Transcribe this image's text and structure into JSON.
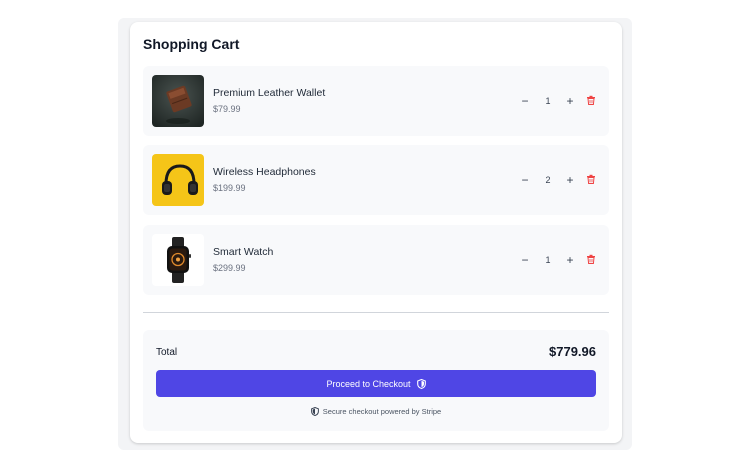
{
  "cart": {
    "title": "Shopping Cart",
    "items": [
      {
        "name": "Premium Leather Wallet",
        "price": "$79.99",
        "quantity": "1"
      },
      {
        "name": "Wireless Headphones",
        "price": "$199.99",
        "quantity": "2"
      },
      {
        "name": "Smart Watch",
        "price": "$299.99",
        "quantity": "1"
      }
    ],
    "controls": {
      "decrease": "−",
      "increase": "+"
    }
  },
  "summary": {
    "total_label": "Total",
    "total_value": "$779.96",
    "checkout_label": "Proceed to Checkout",
    "secure_note": "Secure checkout powered by Stripe"
  },
  "colors": {
    "accent": "#4f46e5",
    "delete": "#ef4444",
    "item_bg": "#f8f9fb"
  },
  "icons": {
    "checkout": "shield-icon",
    "secure": "shield-icon",
    "delete": "trash-icon"
  }
}
